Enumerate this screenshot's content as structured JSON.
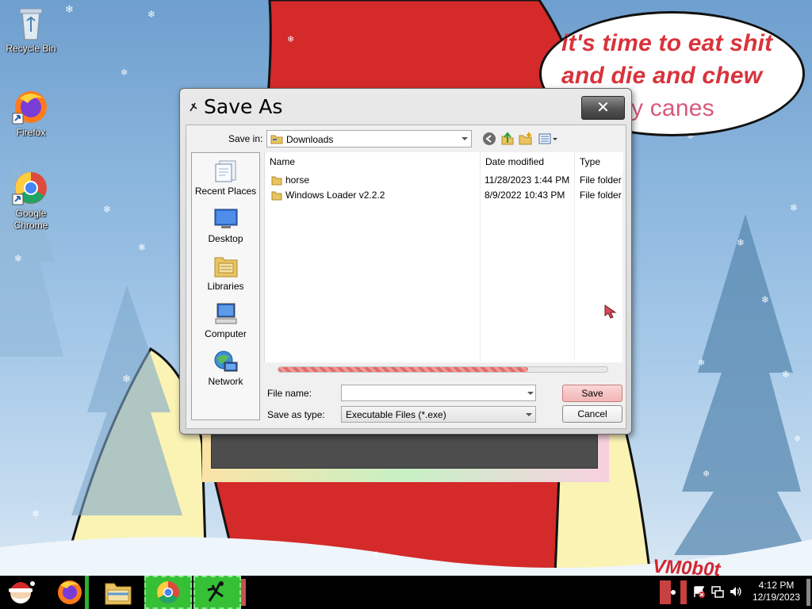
{
  "desktop": {
    "icons": [
      {
        "label": "Recycle Bin",
        "icon": "recycle-bin-icon"
      },
      {
        "label": "Firefox",
        "icon": "firefox-icon"
      },
      {
        "label": "Google Chrome",
        "icon": "chrome-icon"
      }
    ],
    "wallpaper": {
      "speech_line1": "it's time to eat shit",
      "speech_line2": "and die and chew",
      "speech_line3": "y canes",
      "signature": "VM0b0t"
    }
  },
  "dialog": {
    "title": "Save As",
    "close_label": "✕",
    "save_in_label": "Save in:",
    "save_in_value": "Downloads",
    "toolbar": [
      "back-icon",
      "up-folder-icon",
      "new-folder-icon",
      "view-menu-icon"
    ],
    "places": [
      {
        "label": "Recent Places",
        "icon": "recent-places-icon"
      },
      {
        "label": "Desktop",
        "icon": "desktop-icon"
      },
      {
        "label": "Libraries",
        "icon": "libraries-icon"
      },
      {
        "label": "Computer",
        "icon": "computer-icon"
      },
      {
        "label": "Network",
        "icon": "network-icon"
      }
    ],
    "columns": {
      "name": "Name",
      "date": "Date modified",
      "type": "Type"
    },
    "files": [
      {
        "name": "horse",
        "date": "11/28/2023 1:44 PM",
        "type": "File folder"
      },
      {
        "name": "Windows Loader v2.2.2",
        "date": "8/9/2022 10:43 PM",
        "type": "File folder"
      }
    ],
    "progress_fraction": 0.76,
    "file_name_label": "File name:",
    "file_name_value": "",
    "save_as_type_label": "Save as type:",
    "save_as_type_value": "Executable Files (*.exe)",
    "save_label": "Save",
    "cancel_label": "Cancel"
  },
  "taskbar": {
    "buttons": [
      "santa-start-icon",
      "firefox-icon",
      "file-explorer-icon",
      "chrome-icon",
      "app-icon"
    ],
    "clock_time": "4:12 PM",
    "clock_date": "12/19/2023"
  },
  "colors": {
    "accent_red": "#d8333c",
    "progress_red": "#e26a6a",
    "save_button_pink": "#f2b5b5"
  }
}
